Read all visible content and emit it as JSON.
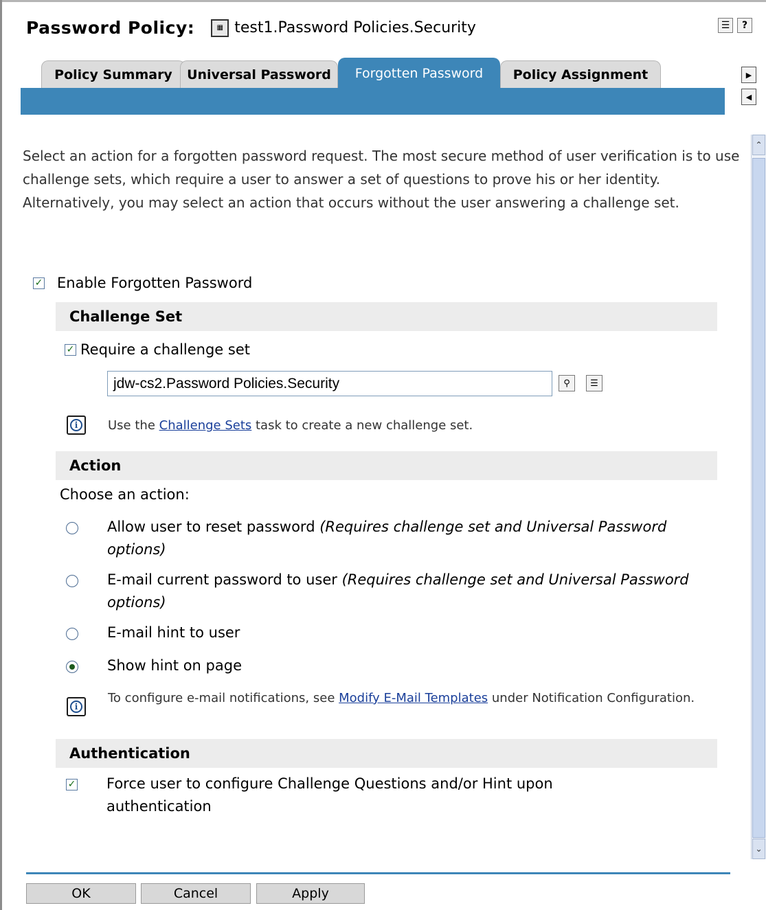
{
  "header": {
    "title_label": "Password Policy:",
    "object_name": "test1.Password Policies.Security",
    "icons": [
      "select-object-icon",
      "help-icon"
    ]
  },
  "tabs": [
    {
      "label": "Policy Summary",
      "active": false
    },
    {
      "label": "Universal Password",
      "active": false
    },
    {
      "label": "Forgotten Password",
      "active": true
    },
    {
      "label": "Policy Assignment",
      "active": false
    }
  ],
  "intro": "Select an action for a forgotten password request. The most secure method of user verification is to use challenge sets, which require a user to answer a set of questions to prove his or her identity. Alternatively, you may select an action that occurs without the user answering a challenge set.",
  "enable_forgotten": {
    "label": "Enable Forgotten Password",
    "checked": true
  },
  "challenge_set": {
    "heading": "Challenge Set",
    "require_label": "Require a challenge set",
    "require_checked": true,
    "value": "jdw-cs2.Password Policies.Security",
    "note_before": "Use the ",
    "note_link": "Challenge Sets",
    "note_after": " task to create a new challenge set."
  },
  "action": {
    "heading": "Action",
    "choose_label": "Choose an action:",
    "options": [
      {
        "label": "Allow user to reset password ",
        "note": "(Requires challenge set and Universal Password options)",
        "selected": false
      },
      {
        "label": "E-mail current password to user ",
        "note": "(Requires challenge set and Universal Password options)",
        "selected": false
      },
      {
        "label": "E-mail hint to user",
        "note": "",
        "selected": false
      },
      {
        "label": "Show hint on page",
        "note": "",
        "selected": true
      }
    ],
    "note_before": "To configure e-mail notifications, see ",
    "note_link": "Modify E-Mail Templates",
    "note_after": " under Notification Configuration."
  },
  "authentication": {
    "heading": "Authentication",
    "force_label": "Force user to configure Challenge Questions and/or Hint upon authentication",
    "force_checked": true
  },
  "buttons": {
    "ok": "OK",
    "cancel": "Cancel",
    "apply": "Apply"
  },
  "colors": {
    "accent": "#3d86b8",
    "section_bg": "#ececec",
    "link": "#1a3f9a"
  }
}
